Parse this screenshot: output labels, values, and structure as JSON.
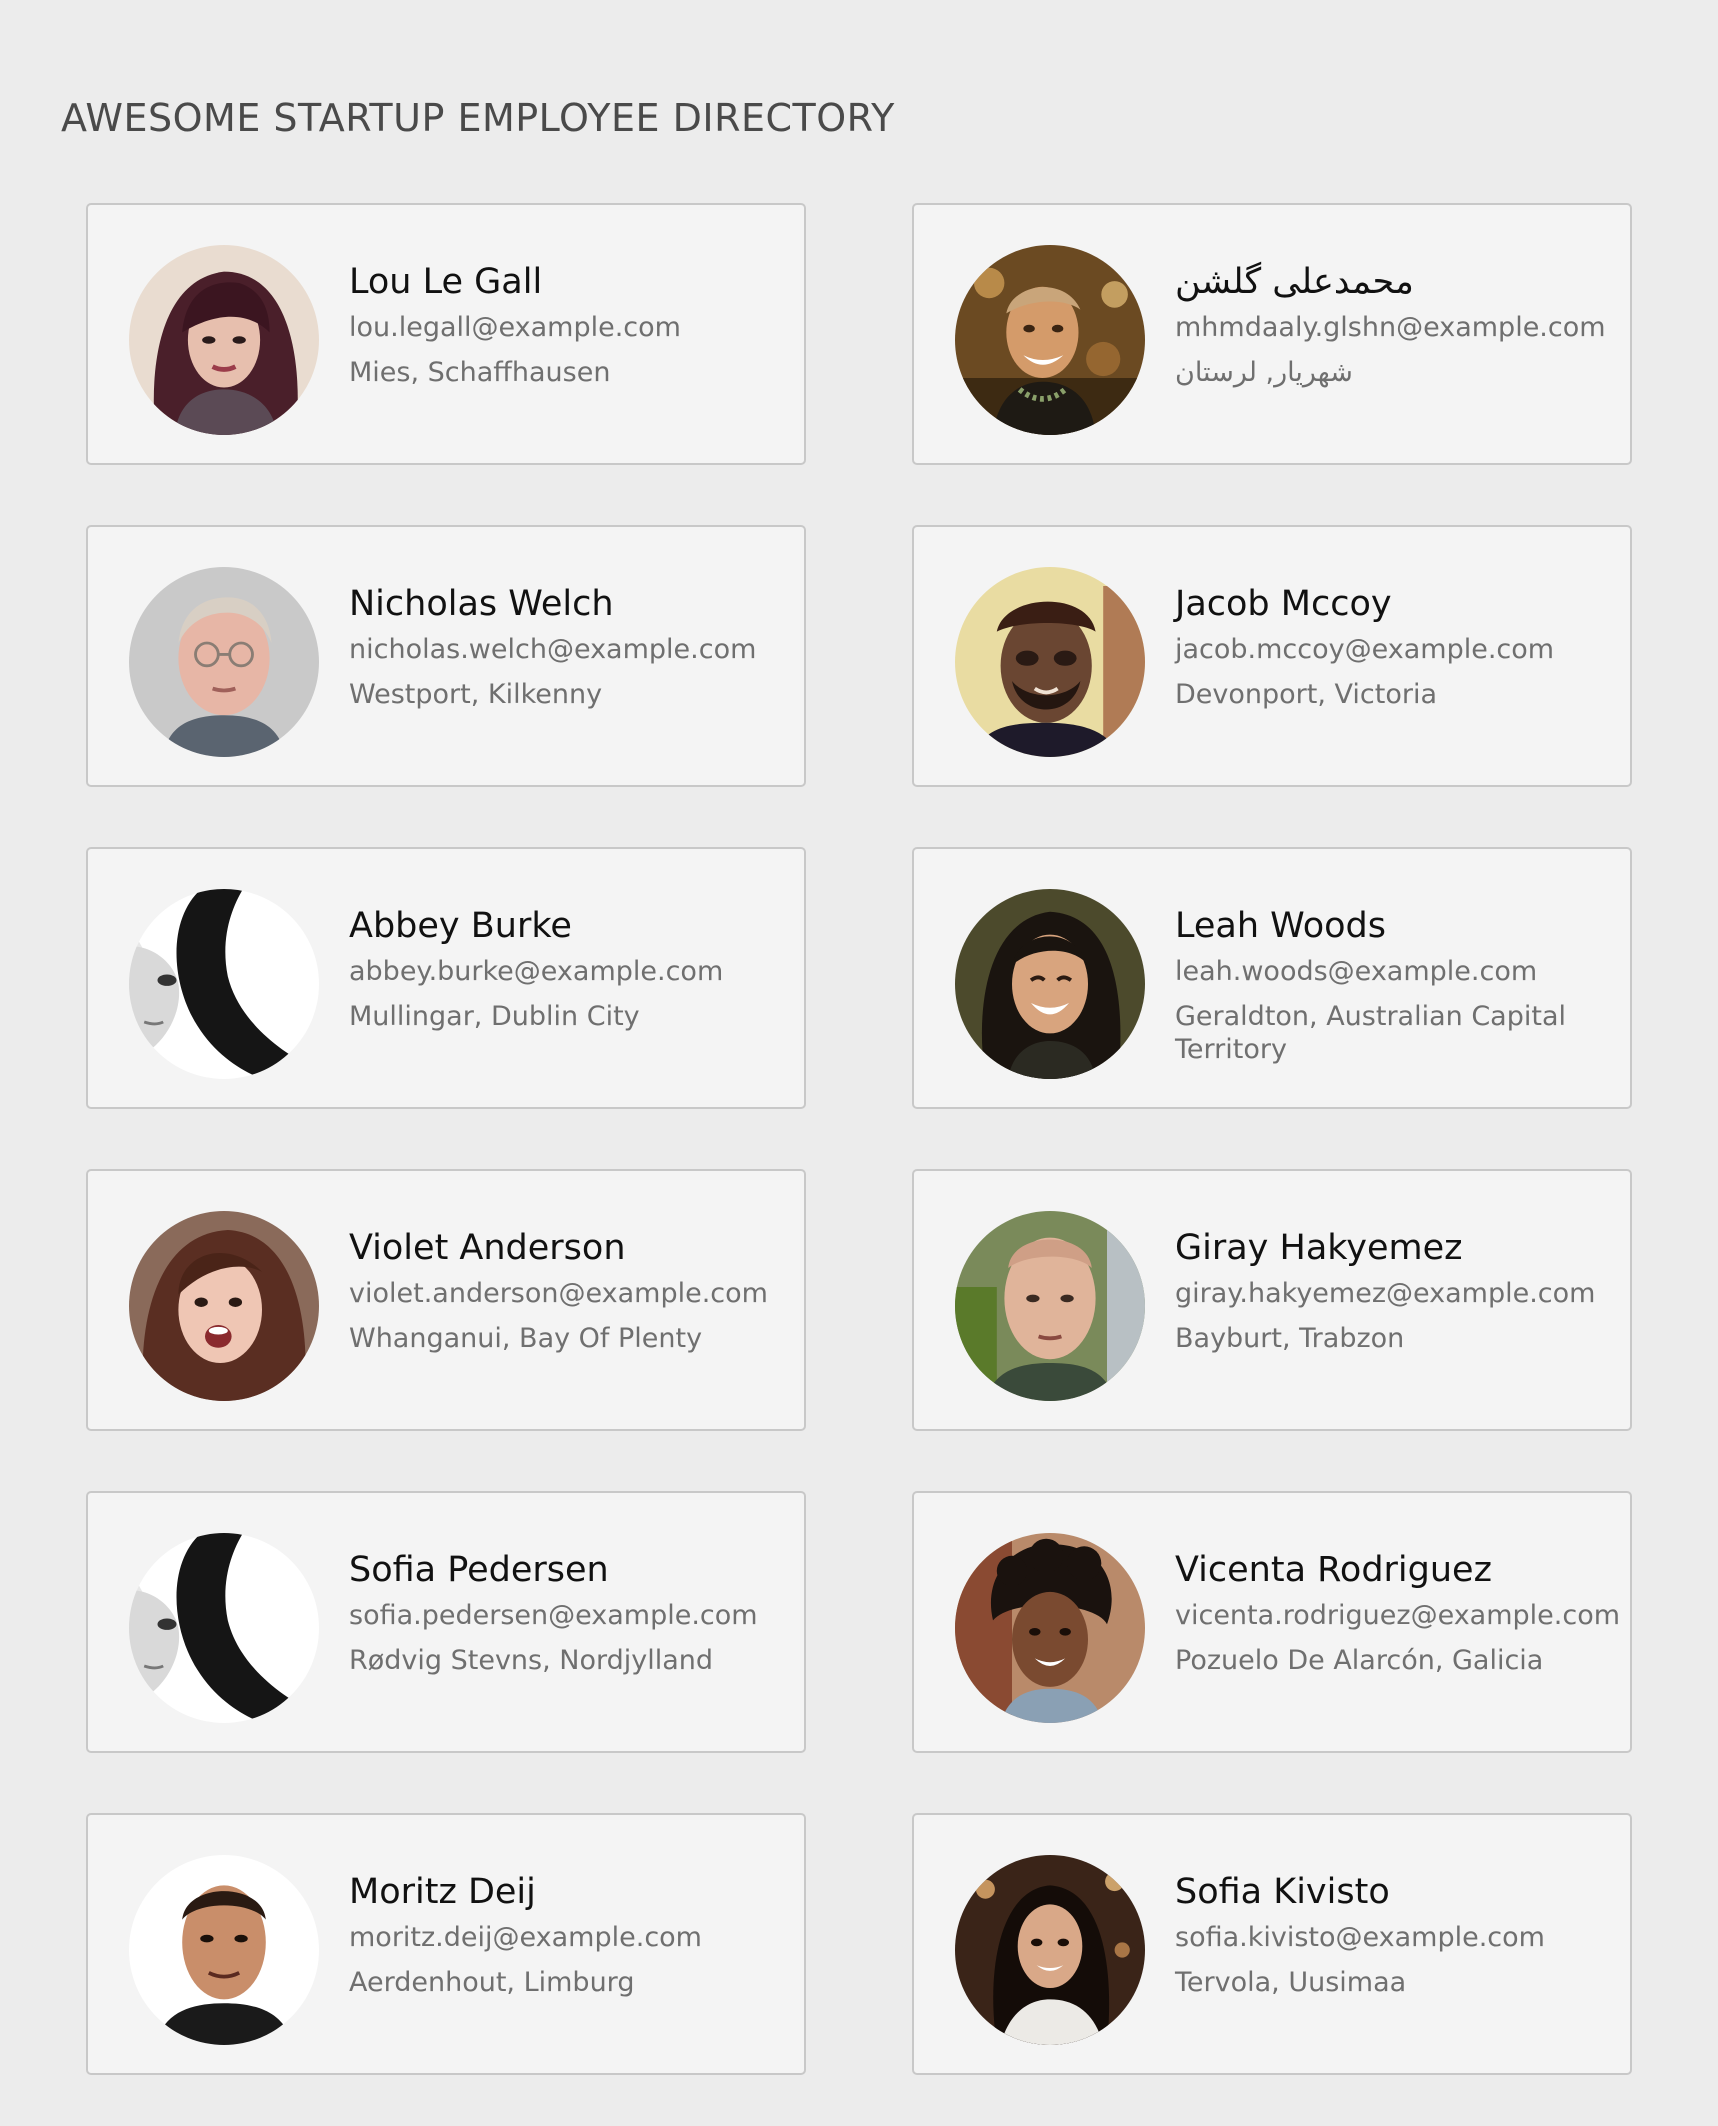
{
  "page": {
    "title": "AWESOME STARTUP EMPLOYEE DIRECTORY"
  },
  "employees": [
    {
      "name": "Lou Le Gall",
      "email": "lou.legall@example.com",
      "location": "Mies, Schaffhausen",
      "avatar": "avatar-woman-brown-hair"
    },
    {
      "name": "محمدعلی گلشن",
      "email": "mhmdaaly.glshn@example.com",
      "location": "شهریار, لرستان",
      "avatar": "avatar-man-smiling-outdoors"
    },
    {
      "name": "Nicholas Welch",
      "email": "nicholas.welch@example.com",
      "location": "Westport, Kilkenny",
      "avatar": "avatar-man-glasses-bald"
    },
    {
      "name": "Jacob Mccoy",
      "email": "jacob.mccoy@example.com",
      "location": "Devonport, Victoria",
      "avatar": "avatar-man-beard-cap"
    },
    {
      "name": "Abbey Burke",
      "email": "abbey.burke@example.com",
      "location": "Mullingar, Dublin City",
      "avatar": "avatar-woman-monochrome-profile"
    },
    {
      "name": "Leah Woods",
      "email": "leah.woods@example.com",
      "location": "Geraldton, Australian Capital Territory",
      "avatar": "avatar-woman-smiling-dark-hair"
    },
    {
      "name": "Violet Anderson",
      "email": "violet.anderson@example.com",
      "location": "Whanganui, Bay Of Plenty",
      "avatar": "avatar-woman-surprised"
    },
    {
      "name": "Giray Hakyemez",
      "email": "giray.hakyemez@example.com",
      "location": "Bayburt, Trabzon",
      "avatar": "avatar-man-shaved-head"
    },
    {
      "name": "Sofia Pedersen",
      "email": "sofia.pedersen@example.com",
      "location": "Rødvig Stevns, Nordjylland",
      "avatar": "avatar-woman-monochrome-profile"
    },
    {
      "name": "Vicenta Rodriguez",
      "email": "vicenta.rodriguez@example.com",
      "location": "Pozuelo De Alarcón, Galicia",
      "avatar": "avatar-woman-curly-hair"
    },
    {
      "name": "Moritz Deij",
      "email": "moritz.deij@example.com",
      "location": "Aerdenhout, Limburg",
      "avatar": "avatar-man-portrait-white-background"
    },
    {
      "name": "Sofia Kivisto",
      "email": "sofia.kivisto@example.com",
      "location": "Tervola, Uusimaa",
      "avatar": "avatar-woman-dark-hair-lights"
    }
  ],
  "colors": {
    "background": "#ececec",
    "card_background": "#f4f4f4",
    "card_border": "#c8c8c8",
    "name_text": "#111111",
    "secondary_text": "#6f6f6f",
    "title_text": "#4a4a4a"
  }
}
